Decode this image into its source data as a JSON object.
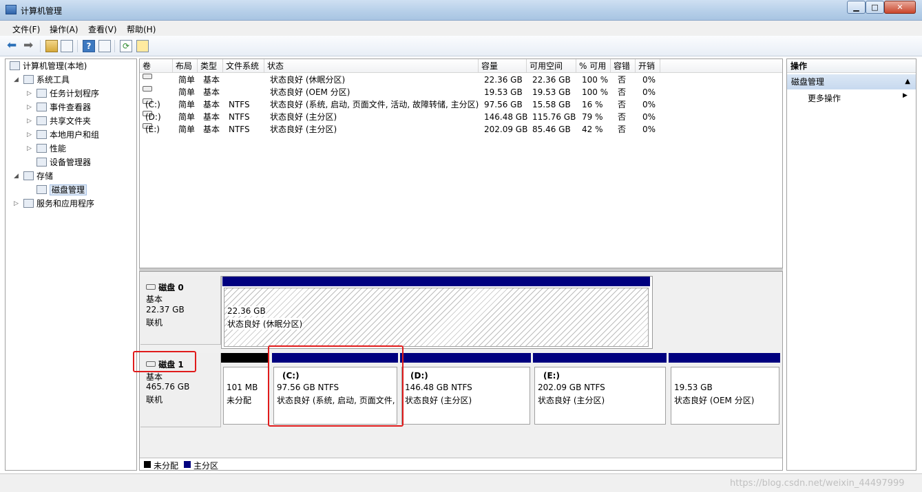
{
  "window": {
    "title": "计算机管理",
    "min": "▁",
    "max": "□",
    "close": "✕"
  },
  "menu": [
    "文件(F)",
    "操作(A)",
    "查看(V)",
    "帮助(H)"
  ],
  "toolbar": {
    "back": "⬅",
    "forward": "➡",
    "help": "?",
    "refresh": "⟳"
  },
  "tree": {
    "root": "计算机管理(本地)",
    "system_tools": "系统工具",
    "task_scheduler": "任务计划程序",
    "event_viewer": "事件查看器",
    "shared_folders": "共享文件夹",
    "local_users": "本地用户和组",
    "performance": "性能",
    "device_manager": "设备管理器",
    "storage": "存储",
    "disk_management": "磁盘管理",
    "services": "服务和应用程序"
  },
  "volume_columns": [
    "卷",
    "布局",
    "类型",
    "文件系统",
    "状态",
    "容量",
    "可用空间",
    "% 可用",
    "容错",
    "开销"
  ],
  "volumes": [
    {
      "name": "",
      "layout": "简单",
      "type": "基本",
      "fs": "",
      "status": "状态良好 (休眠分区)",
      "capacity": "22.36 GB",
      "free": "22.36 GB",
      "pct": "100 %",
      "fault": "否",
      "overhead": "0%"
    },
    {
      "name": "",
      "layout": "简单",
      "type": "基本",
      "fs": "",
      "status": "状态良好 (OEM 分区)",
      "capacity": "19.53 GB",
      "free": "19.53 GB",
      "pct": "100 %",
      "fault": "否",
      "overhead": "0%"
    },
    {
      "name": "(C:)",
      "layout": "简单",
      "type": "基本",
      "fs": "NTFS",
      "status": "状态良好 (系统, 启动, 页面文件, 活动, 故障转储, 主分区)",
      "capacity": "97.56 GB",
      "free": "15.58 GB",
      "pct": "16 %",
      "fault": "否",
      "overhead": "0%"
    },
    {
      "name": "(D:)",
      "layout": "简单",
      "type": "基本",
      "fs": "NTFS",
      "status": "状态良好 (主分区)",
      "capacity": "146.48 GB",
      "free": "115.76 GB",
      "pct": "79 %",
      "fault": "否",
      "overhead": "0%"
    },
    {
      "name": "(E:)",
      "layout": "简单",
      "type": "基本",
      "fs": "NTFS",
      "status": "状态良好 (主分区)",
      "capacity": "202.09 GB",
      "free": "85.46 GB",
      "pct": "42 %",
      "fault": "否",
      "overhead": "0%"
    }
  ],
  "disks": [
    {
      "name": "磁盘 0",
      "type": "基本",
      "size": "22.37 GB",
      "state": "联机",
      "partitions": [
        {
          "size": "22.36 GB",
          "status": "状态良好 (休眠分区)"
        }
      ]
    },
    {
      "name": "磁盘 1",
      "type": "基本",
      "size": "465.76 GB",
      "state": "联机",
      "partitions": [
        {
          "size": "101 MB",
          "status": "未分配"
        },
        {
          "label": "(C:)",
          "size": "97.56 GB NTFS",
          "status": "状态良好 (系统, 启动, 页面文件,"
        },
        {
          "label": "(D:)",
          "size": "146.48 GB NTFS",
          "status": "状态良好 (主分区)"
        },
        {
          "label": "(E:)",
          "size": "202.09 GB NTFS",
          "status": "状态良好 (主分区)"
        },
        {
          "size": "19.53 GB",
          "status": "状态良好 (OEM 分区)"
        }
      ]
    }
  ],
  "legend": {
    "unallocated": "未分配",
    "primary": "主分区"
  },
  "colors": {
    "primary": "#00007f",
    "unallocated": "#000000",
    "highlight": "#e01b1b"
  },
  "actions": {
    "header": "操作",
    "selected": "磁盘管理",
    "more": "更多操作"
  },
  "watermark": "https://blog.csdn.net/weixin_44497999"
}
